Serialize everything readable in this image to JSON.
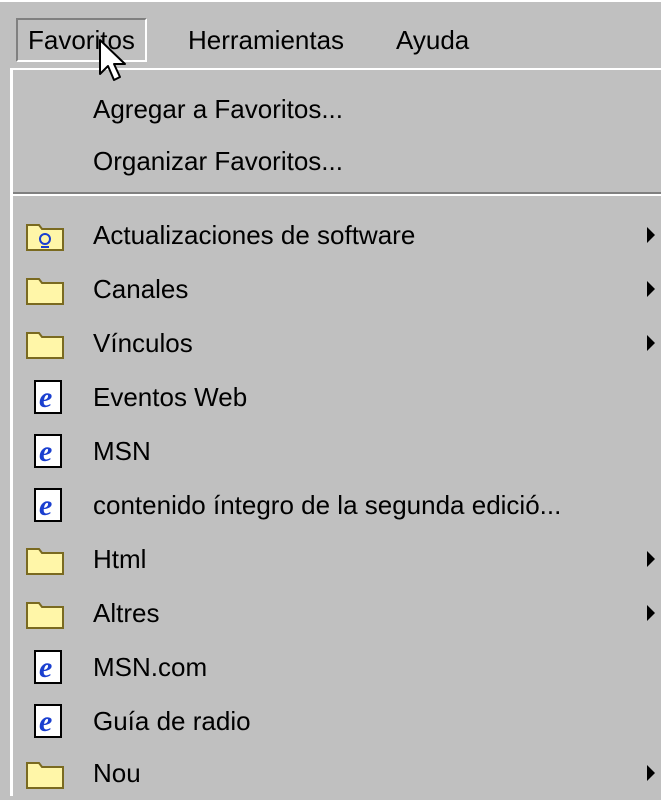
{
  "menubar": {
    "items": [
      {
        "label": "Favoritos",
        "active": true
      },
      {
        "label": "Herramientas",
        "active": false
      },
      {
        "label": "Ayuda",
        "active": false
      }
    ]
  },
  "favorites_menu": {
    "commands": [
      {
        "label": "Agregar a Favoritos..."
      },
      {
        "label": "Organizar Favoritos..."
      }
    ],
    "entries": [
      {
        "label": "Actualizaciones de software",
        "icon": "special-folder-icon",
        "submenu": true
      },
      {
        "label": "Canales",
        "icon": "folder-icon",
        "submenu": true
      },
      {
        "label": "Vínculos",
        "icon": "folder-icon",
        "submenu": true
      },
      {
        "label": "Eventos Web",
        "icon": "internet-shortcut-icon",
        "submenu": false
      },
      {
        "label": "MSN",
        "icon": "internet-shortcut-icon",
        "submenu": false
      },
      {
        "label": "contenido íntegro de la segunda edició...",
        "icon": "internet-shortcut-icon",
        "submenu": false
      },
      {
        "label": "Html",
        "icon": "folder-icon",
        "submenu": true
      },
      {
        "label": "Altres",
        "icon": "folder-icon",
        "submenu": true
      },
      {
        "label": "MSN.com",
        "icon": "internet-shortcut-icon",
        "submenu": false
      },
      {
        "label": "Guía de radio",
        "icon": "internet-shortcut-icon",
        "submenu": false
      },
      {
        "label": "Nou",
        "icon": "folder-icon",
        "submenu": true
      }
    ]
  },
  "colors": {
    "face": "#c0c0c0",
    "highlight": "#ffffff",
    "shadow": "#808080",
    "folder": "#fff6a8",
    "ie_blue": "#1a3fd0"
  }
}
